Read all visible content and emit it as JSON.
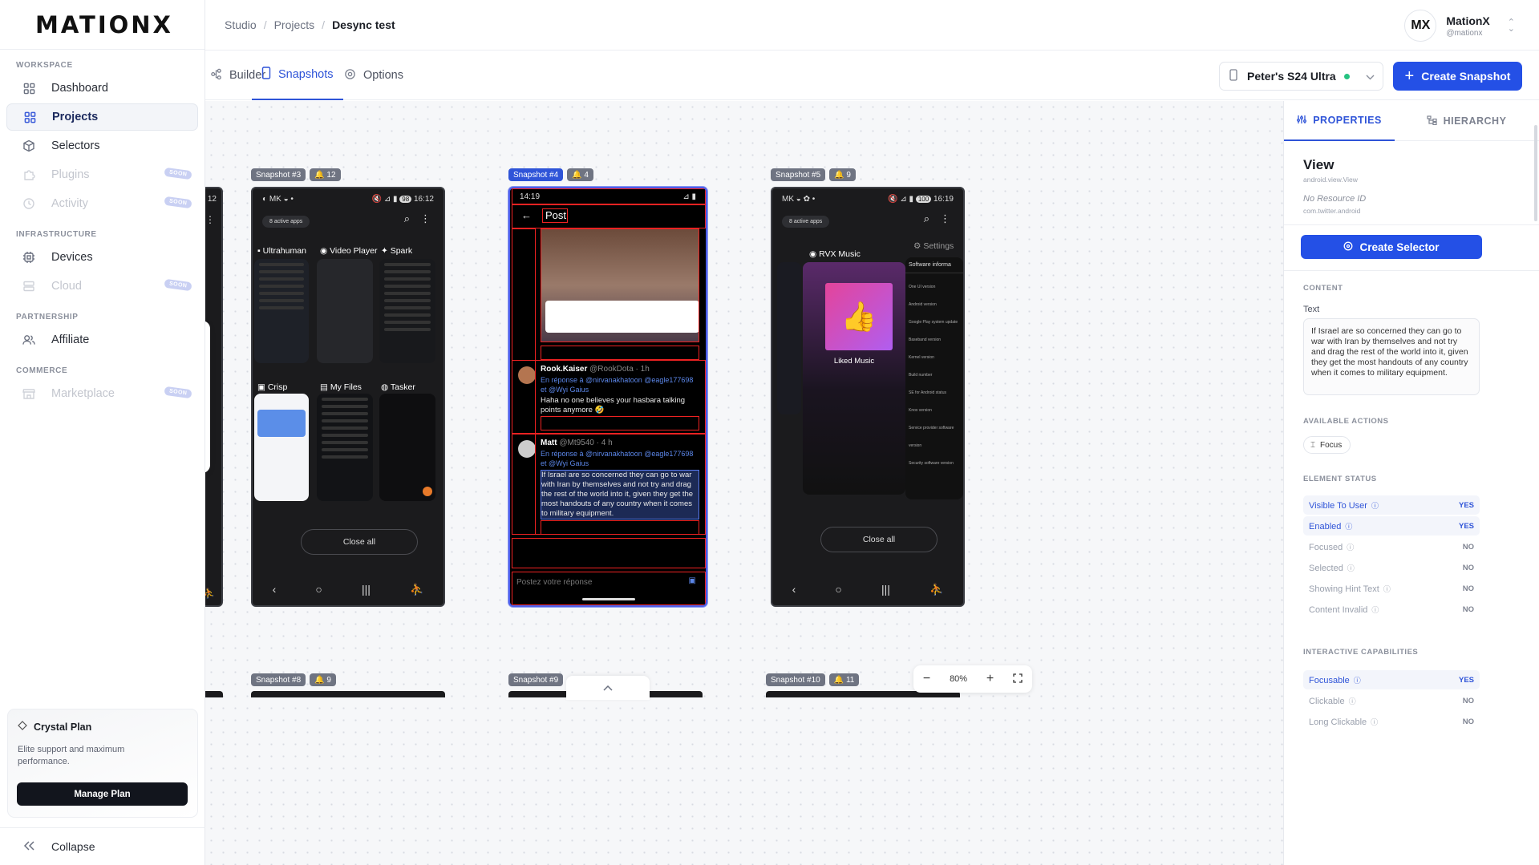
{
  "app": {
    "logo": "MATIONX"
  },
  "sidebar": {
    "sections": {
      "workspace": "WORKSPACE",
      "infrastructure": "INFRASTRUCTURE",
      "partnership": "PARTNERSHIP",
      "commerce": "COMMERCE"
    },
    "items": {
      "dashboard": "Dashboard",
      "projects": "Projects",
      "selectors": "Selectors",
      "plugins": "Plugins",
      "activity": "Activity",
      "devices": "Devices",
      "cloud": "Cloud",
      "affiliate": "Affiliate",
      "marketplace": "Marketplace"
    },
    "soon_badge": "SOON",
    "plan": {
      "title": "Crystal Plan",
      "description": "Elite support and maximum performance.",
      "button": "Manage Plan"
    },
    "collapse": "Collapse"
  },
  "header": {
    "breadcrumb": [
      "Studio",
      "Projects",
      "Desync test"
    ],
    "user": {
      "initials": "MX",
      "name": "MationX",
      "handle": "@mationx"
    }
  },
  "tabs": {
    "builder": "Builder",
    "snapshots": "Snapshots",
    "options": "Options"
  },
  "device": {
    "name": "Peter's S24 Ultra",
    "status_color": "#26c281"
  },
  "create_snapshot": "Create Snapshot",
  "canvas": {
    "snapshots": [
      {
        "label": "Snapshot #3",
        "count": "12"
      },
      {
        "label": "Snapshot #4",
        "count": "4"
      },
      {
        "label": "Snapshot #5",
        "count": "9"
      },
      {
        "label": "Snapshot #8",
        "count": "9"
      },
      {
        "label": "Snapshot #9",
        "count": ""
      },
      {
        "label": "Snapshot #10",
        "count": "11"
      }
    ],
    "left_phone_partial": {
      "time": "12"
    },
    "phone3": {
      "time": "16:12",
      "battery": "98",
      "active_apps": "8 active apps",
      "apps": [
        "Ultrahuman",
        "Video Player",
        "Spark",
        "Crisp",
        "My Files",
        "Tasker"
      ],
      "close_all": "Close all"
    },
    "phone4": {
      "time": "14:19",
      "header": "Post",
      "tweets": [
        {
          "author": "Rook.Kaiser",
          "meta": "@RookDota · 1h",
          "reply_to": "En réponse à @nirvanakhatoon @eagle177698 et @Wyi Gaius",
          "text": "Haha no one believes your hasbara talking points anymore 🤣"
        },
        {
          "author": "Matt",
          "meta": "@Mt9540 · 4 h",
          "reply_to": "En réponse à @nirvanakhatoon @eagle177698 et @Wyi Gaius",
          "text": "If Israel are so concerned they can go to war with Iran by themselves and not try and drag the rest of the world into it, given they get the most handouts of any country when it comes to military equipment."
        }
      ],
      "reply_placeholder": "Postez votre réponse"
    },
    "phone5": {
      "time": "16:19",
      "battery": "100",
      "active_apps": "8 active apps",
      "app_title": "RVX Music",
      "settings": "Settings",
      "card_title": "Liked Music",
      "settings_panel_title": "Software informa",
      "settings_items": [
        "One UI version",
        "Android version",
        "Google Play system update",
        "Baseband version",
        "Kernel version",
        "Build number",
        "SE for Android status",
        "Knox version",
        "Service provider software version",
        "Security software version"
      ],
      "close_all": "Close all"
    },
    "zoom": "80%"
  },
  "panel": {
    "tabs": {
      "properties": "PROPERTIES",
      "hierarchy": "HIERARCHY"
    },
    "element": {
      "title": "View",
      "class_name": "android.view.View",
      "resource_id": "No Resource ID",
      "package": "com.twitter.android"
    },
    "create_selector": "Create Selector",
    "content_section": "CONTENT",
    "text_label": "Text",
    "text_value": "If Israel are so concerned they can go to war with Iran by themselves and not try and drag the rest of the world into it, given they get the most handouts of any country when it comes to military equipment.",
    "actions_section": "AVAILABLE ACTIONS",
    "actions": [
      "Focus"
    ],
    "status_section": "ELEMENT STATUS",
    "status": [
      {
        "label": "Visible To User",
        "value": "YES",
        "on": true
      },
      {
        "label": "Enabled",
        "value": "YES",
        "on": true
      },
      {
        "label": "Focused",
        "value": "NO",
        "on": false
      },
      {
        "label": "Selected",
        "value": "NO",
        "on": false
      },
      {
        "label": "Showing Hint Text",
        "value": "NO",
        "on": false
      },
      {
        "label": "Content Invalid",
        "value": "NO",
        "on": false
      }
    ],
    "capabilities_section": "INTERACTIVE CAPABILITIES",
    "capabilities": [
      {
        "label": "Focusable",
        "value": "YES",
        "on": true
      },
      {
        "label": "Clickable",
        "value": "NO",
        "on": false
      },
      {
        "label": "Long Clickable",
        "value": "NO",
        "on": false
      }
    ]
  }
}
